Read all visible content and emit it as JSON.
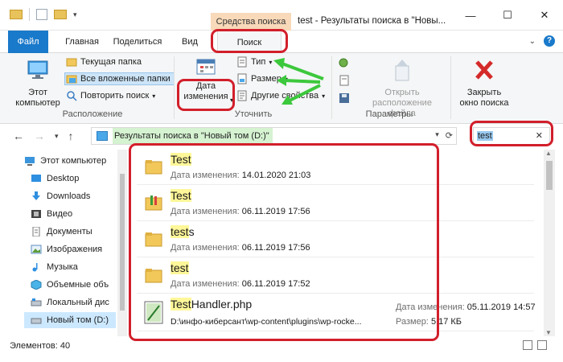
{
  "window": {
    "contextual_group": "Средства поиска",
    "title": "test - Результаты поиска в \"Новы...",
    "minimize": "—",
    "maximize": "☐",
    "close": "✕"
  },
  "tabs": {
    "file": "Файл",
    "home": "Главная",
    "share": "Поделиться",
    "view": "Вид",
    "search": "Поиск"
  },
  "ribbon": {
    "location": {
      "this_pc": "Этот компьютер",
      "current_folder": "Текущая папка",
      "all_subfolders": "Все вложенные папки",
      "repeat_search": "Повторить поиск",
      "group_label": "Расположение"
    },
    "refine": {
      "date_modified": "Дата изменения",
      "type": "Тип",
      "size": "Размер",
      "other_properties": "Другие свойства",
      "group_label": "Уточнить"
    },
    "options": {
      "open_location": "Открыть расположение файла",
      "group_label": "Параметры"
    },
    "close_search": "Закрыть окно поиска"
  },
  "address": {
    "path_prefix": "Результаты поиска в",
    "path_target": "\"Новый том (D:)\"",
    "search_value": "test",
    "search_clear": "✕"
  },
  "nav": {
    "items": [
      {
        "label": "Этот компьютер",
        "icon": "computer-icon"
      },
      {
        "label": "Desktop",
        "icon": "desktop-icon"
      },
      {
        "label": "Downloads",
        "icon": "downloads-icon"
      },
      {
        "label": "Видео",
        "icon": "video-icon"
      },
      {
        "label": "Документы",
        "icon": "documents-icon"
      },
      {
        "label": "Изображения",
        "icon": "pictures-icon"
      },
      {
        "label": "Музыка",
        "icon": "music-icon"
      },
      {
        "label": "Объемные объ",
        "icon": "3d-objects-icon"
      },
      {
        "label": "Локальный дис",
        "icon": "local-disk-icon"
      },
      {
        "label": "Новый том (D:)",
        "icon": "drive-icon"
      }
    ]
  },
  "results": [
    {
      "name_hl": "Test",
      "name_rest": "",
      "date_label": "Дата изменения:",
      "date": "14.01.2020 21:03"
    },
    {
      "name_hl": "Test",
      "name_rest": "",
      "date_label": "Дата изменения:",
      "date": "06.11.2019 17:56"
    },
    {
      "name_hl": "test",
      "name_rest": "s",
      "date_label": "Дата изменения:",
      "date": "06.11.2019 17:56"
    },
    {
      "name_hl": "test",
      "name_rest": "",
      "date_label": "Дата изменения:",
      "date": "06.11.2019 17:52"
    },
    {
      "name_hl": "Test",
      "name_rest": "Handler.php",
      "path": "D:\\инфо-киберсант\\wp-content\\plugins\\wp-rocke...",
      "date_label": "Дата изменения:",
      "date": "05.11.2019 14:57",
      "size_label": "Размер:",
      "size": "5,17 КБ"
    }
  ],
  "status": {
    "items_count": "Элементов: 40"
  },
  "colors": {
    "accent": "#1979ca",
    "highlight_box": "#d21f2b",
    "arrow": "#3cc83c",
    "contextual": "#f8d9b9"
  }
}
